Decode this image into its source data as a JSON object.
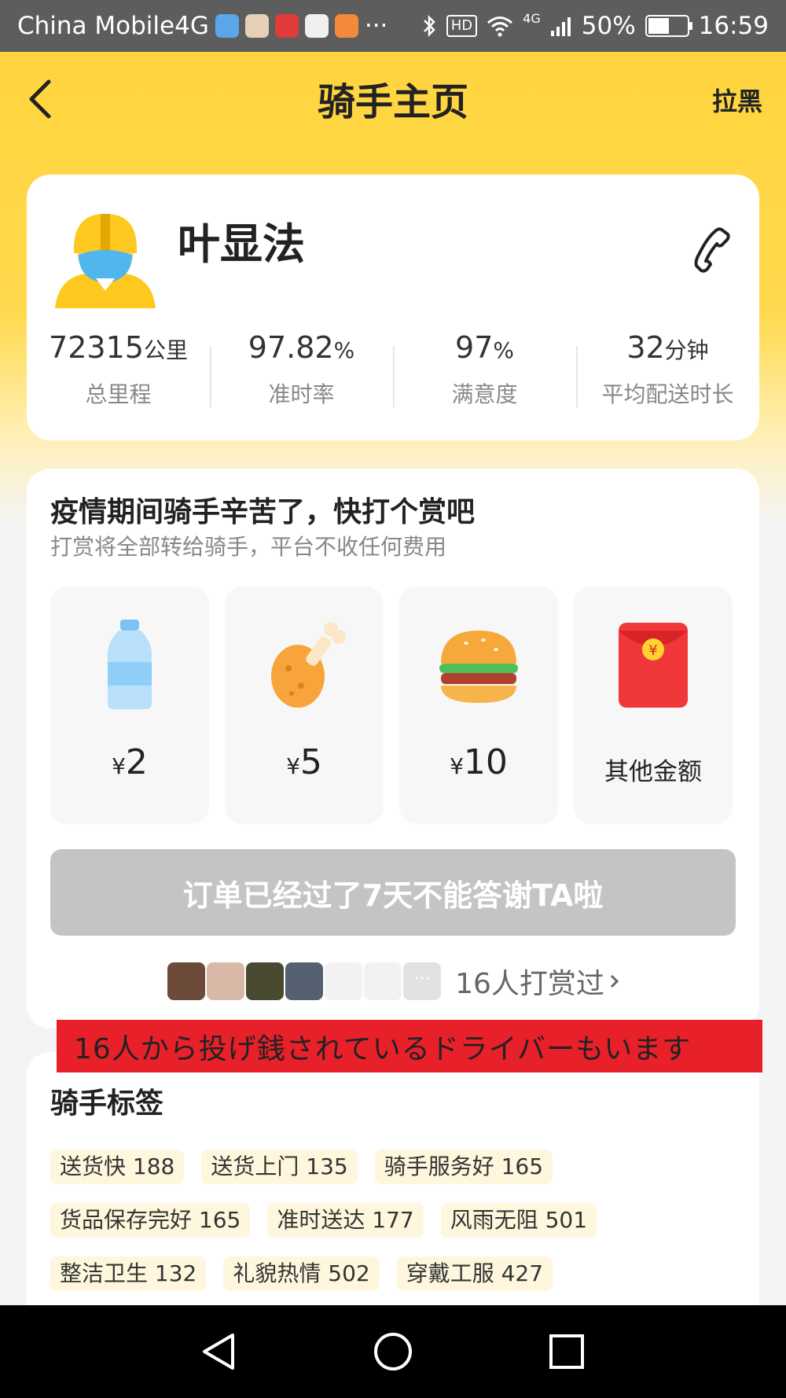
{
  "status_bar": {
    "carrier": "China Mobile4G",
    "more": "···",
    "hd": "HD",
    "network": "4G",
    "battery": "50%",
    "battery_level": 0.5,
    "time": "16:59"
  },
  "header": {
    "title": "骑手主页",
    "action": "拉黑"
  },
  "rider": {
    "name": "叶显法",
    "stats": [
      {
        "value": "72315",
        "unit": "公里",
        "label": "总里程"
      },
      {
        "value": "97.82",
        "unit": "%",
        "label": "准时率"
      },
      {
        "value": "97",
        "unit": "%",
        "label": "满意度"
      },
      {
        "value": "32",
        "unit": "分钟",
        "label": "平均配送时长"
      }
    ]
  },
  "tip": {
    "title": "疫情期间骑手辛苦了，快打个赏吧",
    "subtitle": "打赏将全部转给骑手，平台不收任何费用",
    "currency": "¥",
    "options": [
      {
        "amount": "2",
        "icon": "water-bottle-icon"
      },
      {
        "amount": "5",
        "icon": "chicken-leg-icon"
      },
      {
        "amount": "10",
        "icon": "burger-icon"
      },
      {
        "label": "其他金额",
        "icon": "red-envelope-icon"
      }
    ],
    "disabled_button": "订单已经过了7天不能答谢TA啦",
    "tippers_text": "16人打赏过",
    "more_icon": "···"
  },
  "overlay_banner": "16人から投げ銭されているドライバーもいます",
  "tags": {
    "title": "骑手标签",
    "rows": [
      [
        "送货快 188",
        "送货上门 135",
        "骑手服务好 165"
      ],
      [
        "货品保存完好 165",
        "准时送达 177",
        "风雨无阻 501"
      ],
      [
        "整洁卫生 132",
        "礼貌热情 502",
        "穿戴工服 427"
      ]
    ]
  },
  "colors": {
    "brand_yellow": "#ffd43e",
    "banner_red": "#e8202a",
    "tag_bg": "#fff7dd"
  }
}
